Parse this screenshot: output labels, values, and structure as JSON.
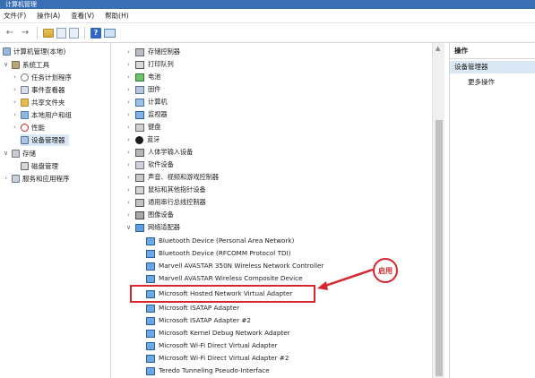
{
  "window": {
    "title": "计算机管理"
  },
  "menu": [
    "文件(F)",
    "操作(A)",
    "查看(V)",
    "帮助(H)"
  ],
  "toolbar": {
    "icons": [
      "back-arrow-icon",
      "forward-arrow-icon",
      "folder-up-icon",
      "console-tree-icon",
      "properties-icon",
      "help-icon",
      "monitor-icon"
    ]
  },
  "left_tree": {
    "items": [
      {
        "label": "计算机管理(本地)"
      },
      {
        "label": "系统工具"
      },
      {
        "label": "任务计划程序"
      },
      {
        "label": "事件查看器"
      },
      {
        "label": "共享文件夹"
      },
      {
        "label": "本地用户和组"
      },
      {
        "label": "性能"
      },
      {
        "label": "设备管理器"
      },
      {
        "label": "存储"
      },
      {
        "label": "磁盘管理"
      },
      {
        "label": "服务和应用程序"
      }
    ]
  },
  "device_list": {
    "categories": [
      {
        "label": "存储控制器"
      },
      {
        "label": "打印队列"
      },
      {
        "label": "电池"
      },
      {
        "label": "固件"
      },
      {
        "label": "计算机"
      },
      {
        "label": "监视器"
      },
      {
        "label": "键盘"
      },
      {
        "label": "蓝牙"
      },
      {
        "label": "人体学输入设备"
      },
      {
        "label": "软件设备"
      },
      {
        "label": "声音、视频和游戏控制器"
      },
      {
        "label": "鼠标和其他指针设备"
      },
      {
        "label": "通用串行总线控制器"
      },
      {
        "label": "图像设备"
      },
      {
        "label": "网络适配器"
      }
    ],
    "network_adapters": [
      {
        "label": "Bluetooth Device (Personal Area Network)"
      },
      {
        "label": "Bluetooth Device (RFCOMM Protocol TDI)"
      },
      {
        "label": "Marvell AVASTAR 350N Wireless Network Controller"
      },
      {
        "label": "Marvell AVASTAR Wireless Composite Device"
      },
      {
        "label": "Microsoft Hosted Network Virtual Adapter"
      },
      {
        "label": "Microsoft ISATAP Adapter"
      },
      {
        "label": "Microsoft ISATAP Adapter #2"
      },
      {
        "label": "Microsoft Kernel Debug Network Adapter"
      },
      {
        "label": "Microsoft Wi-Fi Direct Virtual Adapter"
      },
      {
        "label": "Microsoft Wi-Fi Direct Virtual Adapter #2"
      },
      {
        "label": "Teredo Tunneling Pseudo-Interface"
      }
    ]
  },
  "callout": {
    "label": "启用",
    "color": "#d8262c"
  },
  "actions": {
    "header": "操作",
    "device_manager": "设备管理器",
    "more": "更多操作"
  },
  "colors": {
    "accent": "#3a6fb4",
    "selection": "#dbe8f5"
  }
}
